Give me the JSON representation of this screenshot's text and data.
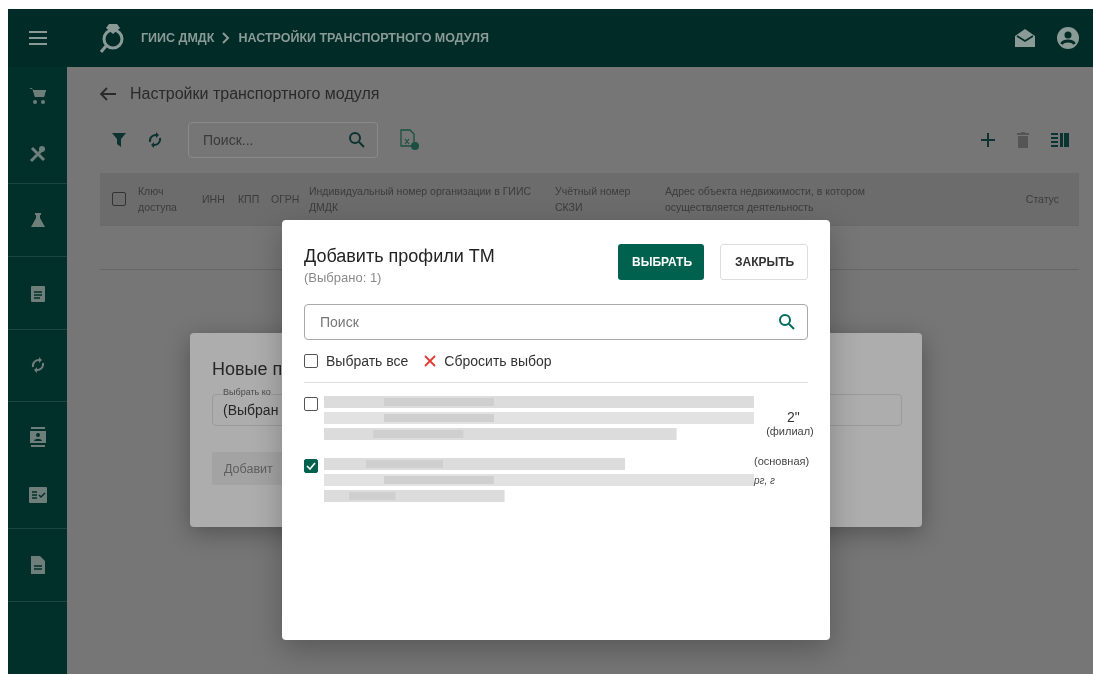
{
  "topbar": {
    "breadcrumb": [
      "ГИИС ДМДК",
      "НАСТРОЙКИ ТРАНСПОРТНОГО МОДУЛЯ"
    ]
  },
  "page": {
    "title": "Настройки транспортного модуля",
    "search": {
      "placeholder": "Поиск..."
    },
    "table": {
      "select_all_checked": false,
      "columns": [
        {
          "label": "Ключ доступа"
        },
        {
          "label": "ИНН"
        },
        {
          "label": "КПП"
        },
        {
          "label": "ОГРН"
        },
        {
          "label": "Индивидуальный номер организации в ГИИС ДМДК"
        },
        {
          "label": "Учётный номер СКЗИ"
        },
        {
          "label": "Адрес объекта недвижимости, в котором осуществляется деятельность"
        },
        {
          "label": "Статус"
        }
      ]
    }
  },
  "back_dialog": {
    "title": "Новые п",
    "field_label": "Выбрать ко",
    "field_value": "(Выбран",
    "button": "Добавит"
  },
  "modal": {
    "title": "Добавить профили ТМ",
    "subtitle": "(Выбрано: 1)",
    "buttons": [
      {
        "label": "ВЫБРАТЬ",
        "kind": "primary"
      },
      {
        "label": "ЗАКРЫТЬ",
        "kind": "outlined"
      }
    ],
    "search": {
      "placeholder": "Поиск"
    },
    "select_all": {
      "label": "Выбрать все",
      "checked": false
    },
    "reset": "Сбросить выбор",
    "items": [
      {
        "checked": false,
        "notes": [
          {
            "text": "2\"",
            "kind": "main"
          },
          {
            "text": "(филиал)",
            "kind": "tag"
          }
        ]
      },
      {
        "checked": true,
        "notes": [
          {
            "text": "(основная)",
            "kind": "tag"
          },
          {
            "text": "рг, г",
            "kind": "tail"
          }
        ]
      }
    ]
  }
}
